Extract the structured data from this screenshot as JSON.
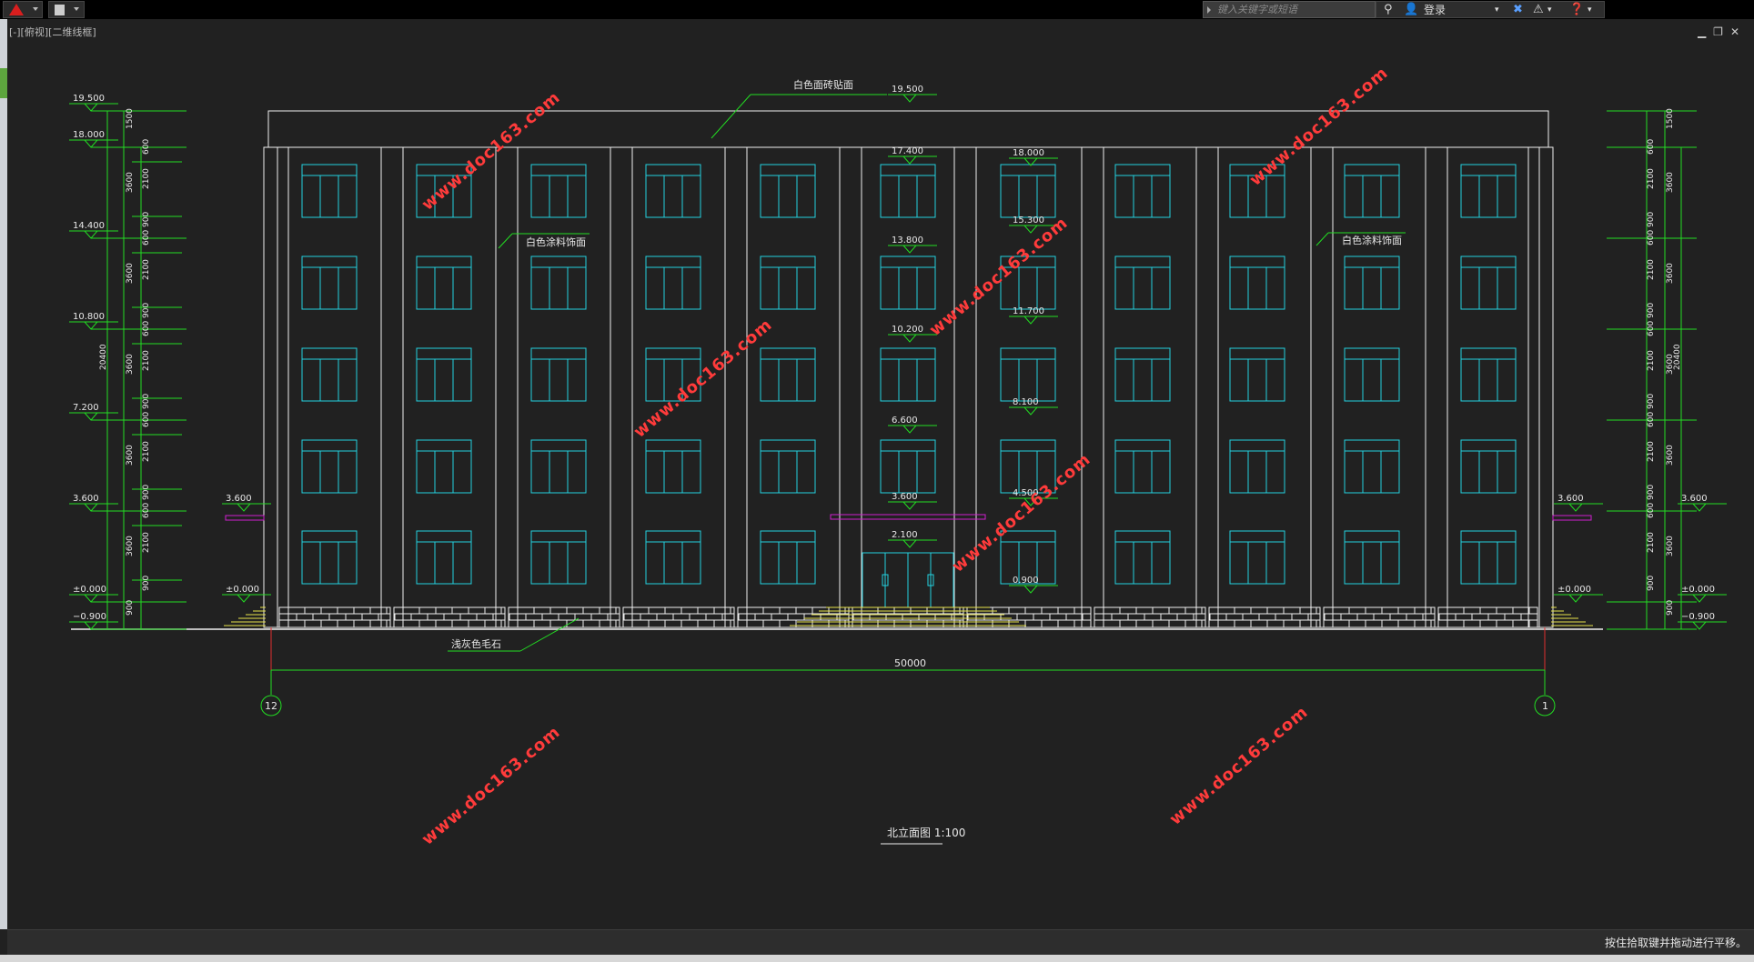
{
  "app": {
    "search_placeholder": "键入关键字或短语",
    "login_label": "登录",
    "viewport_label": "[-][俯视][二维线框]",
    "status_message": "按住拾取键并拖动进行平移。"
  },
  "drawing": {
    "title": "北立面图  1:100",
    "overall_dimension": "50000",
    "grid_axis_left": "12",
    "grid_axis_right": "1",
    "total_height_left": "20400",
    "total_height_right": "20400",
    "notes": {
      "roof_finish": "白色面砖贴面",
      "wall_finish_left": "白色涂料饰面",
      "wall_finish_right": "白色涂料饰面",
      "base_finish": "浅灰色毛石"
    },
    "level_labels_left": [
      "19.500",
      "18.000",
      "14.400",
      "10.800",
      "7.200",
      "3.600",
      "±0.000",
      "−0.900"
    ],
    "level_labels_right": [
      "3.600",
      "±0.000",
      "−0.900"
    ],
    "left_dims_outer": [
      "1500",
      "3600",
      "3600",
      "3600",
      "3600",
      "3600",
      "900"
    ],
    "left_dims_inner": [
      "600",
      "2100",
      "900",
      "600",
      "2100",
      "900",
      "600",
      "2100",
      "900",
      "600",
      "2100",
      "900",
      "600",
      "2100",
      "900"
    ],
    "right_dims_outer": [
      "1500",
      "3600",
      "3600",
      "3600",
      "3600",
      "3600",
      "900"
    ],
    "right_dims_inner": [
      "600",
      "2100",
      "900",
      "600",
      "2100",
      "900",
      "600",
      "2100",
      "900",
      "600",
      "2100",
      "900",
      "600",
      "2100",
      "900"
    ],
    "center_levels_a": [
      "19.500",
      "17.400",
      "13.800",
      "10.200",
      "6.600",
      "3.600",
      "2.100"
    ],
    "center_levels_b": [
      "18.000",
      "15.300",
      "11.700",
      "8.100",
      "4.500",
      "0.900"
    ],
    "canopy_left_level": "3.600",
    "canopy_left_base": "±0.000",
    "canopy_right_level": "3.600",
    "canopy_right_base": "±0.000",
    "watermark": "www.doc163.com"
  },
  "colors": {
    "background": "#212121",
    "outline": "#f0f0f0",
    "window": "#23d1e0",
    "dimension": "#22dd22",
    "accent_magenta": "#d020d0",
    "steps": "#e8e24a",
    "watermark": "#ff3b3b"
  }
}
